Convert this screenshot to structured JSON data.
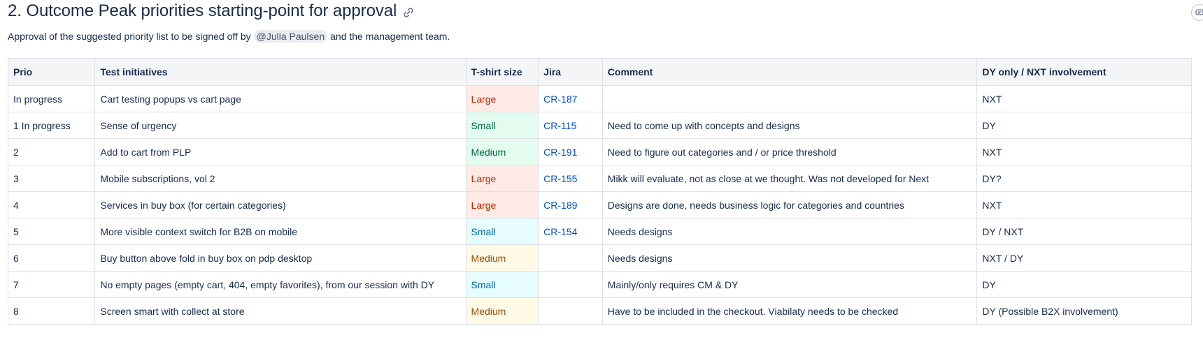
{
  "heading": {
    "title": "2. Outcome Peak priorities starting-point for approval",
    "icon": "link-icon"
  },
  "description": {
    "before": "Approval of the suggested priority list to be signed off by",
    "mention": "@Julia Paulsen",
    "after": "and the management team."
  },
  "table": {
    "headers": [
      "Prio",
      "Test initiatives",
      "T-shirt size",
      "Jira",
      "Comment",
      "DY only / NXT involvement"
    ],
    "rows": [
      {
        "prio": "In progress",
        "initiative": "Cart testing popups vs cart page",
        "size": "Large",
        "size_color": "red",
        "jira": "CR-187",
        "comment": "",
        "involvement": "NXT"
      },
      {
        "prio": "1 In progress",
        "initiative": "Sense of urgency",
        "size": "Small",
        "size_color": "green",
        "jira": "CR-115",
        "comment": "Need to come up with concepts and designs",
        "involvement": "DY"
      },
      {
        "prio": "2",
        "initiative": "Add to cart from PLP",
        "size": "Medium",
        "size_color": "green",
        "jira": "CR-191",
        "comment": "Need to figure out categories and / or price threshold",
        "involvement": "NXT"
      },
      {
        "prio": "3",
        "initiative": "Mobile subscriptions, vol 2",
        "size": "Large",
        "size_color": "red",
        "jira": "CR-155",
        "comment": "Mikk will evaluate, not as close at we thought. Was not developed for Next",
        "involvement": "DY?"
      },
      {
        "prio": "4",
        "initiative": "Services in buy box (for certain categories)",
        "size": "Large",
        "size_color": "red",
        "jira": "CR-189",
        "comment": "Designs are done, needs business logic for categories and countries",
        "involvement": "NXT"
      },
      {
        "prio": "5",
        "initiative": "More visible context switch for B2B on mobile",
        "size": "Small",
        "size_color": "blue",
        "jira": "CR-154",
        "comment": "Needs designs",
        "involvement": "DY / NXT"
      },
      {
        "prio": "6",
        "initiative": "Buy button above fold in buy box on pdp desktop",
        "size": "Medium",
        "size_color": "yellow",
        "jira": "",
        "comment": "Needs designs",
        "involvement": "NXT / DY"
      },
      {
        "prio": "7",
        "initiative": "No empty pages (empty cart, 404, empty favorites), from our session with DY",
        "size": "Small",
        "size_color": "blue",
        "jira": "",
        "comment": "Mainly/only requires CM & DY",
        "involvement": "DY"
      },
      {
        "prio": "8",
        "initiative": "Screen smart with collect at store",
        "size": "Medium",
        "size_color": "yellow",
        "jira": "",
        "comment": "Have to be included in the checkout. Viabilaty needs to be checked",
        "involvement": "DY (Possible B2X involvement)"
      }
    ]
  },
  "colors": {
    "red": "#ffebe6",
    "green": "#e3fcef",
    "blue": "#e6fcff",
    "yellow": "#fffae6",
    "link": "#0052cc"
  }
}
